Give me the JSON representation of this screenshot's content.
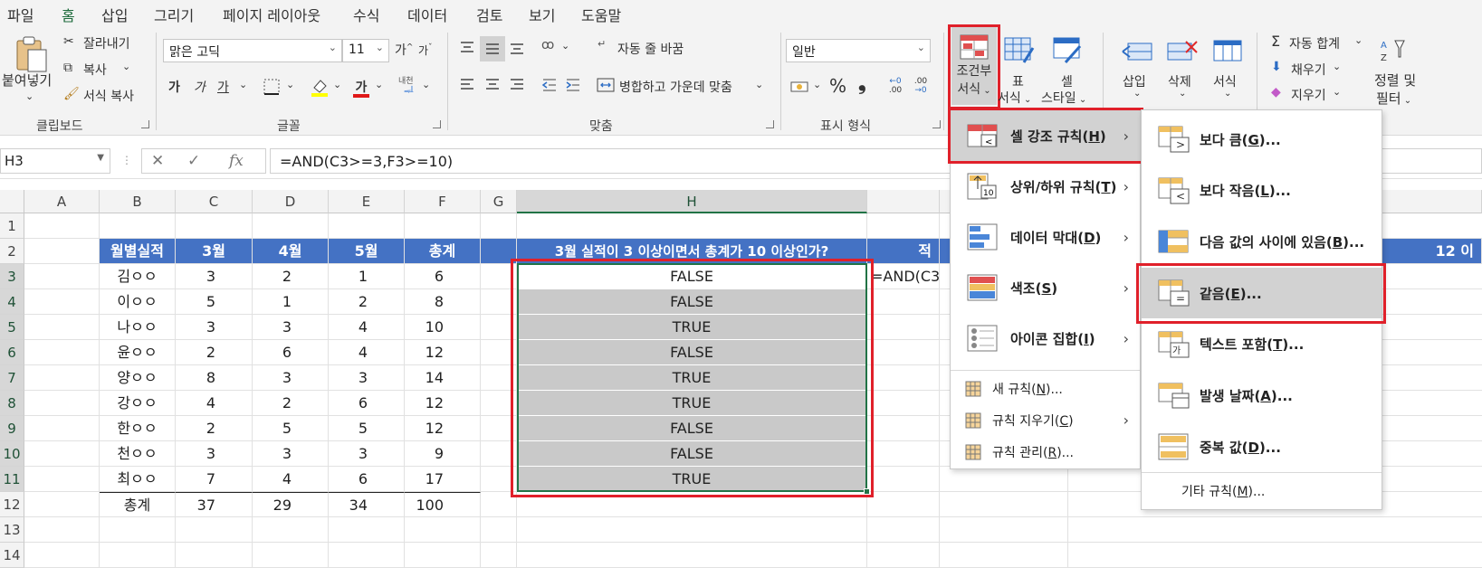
{
  "menubar": {
    "items": [
      "파일",
      "홈",
      "삽입",
      "그리기",
      "페이지 레이아웃",
      "수식",
      "데이터",
      "검토",
      "보기",
      "도움말"
    ],
    "active": "홈"
  },
  "ribbon": {
    "clipboard": {
      "paste": "붙여넣기",
      "cut": "잘라내기",
      "copy": "복사",
      "format_painter": "서식 복사",
      "label": "클립보드"
    },
    "font": {
      "font_name": "맑은 고딕",
      "font_size": "11",
      "grow": "가",
      "shrink": "가",
      "bold": "가",
      "italic": "가",
      "underline": "가",
      "font_color_glyph": "가",
      "phonetic": "내천",
      "label": "글꼴"
    },
    "alignment": {
      "wrap_text": "자동 줄 바꿈",
      "merge_center": "병합하고 가운데 맞춤",
      "label": "맞춤"
    },
    "number": {
      "format": "일반",
      "percent": "%",
      "comma": "❟",
      "inc_decimal": ".00",
      "dec_decimal": ".00",
      "label": "표시 형식"
    },
    "styles": {
      "conditional_line1": "조건부",
      "conditional_line2": "서식",
      "table_line1": "표",
      "table_line2": "서식",
      "cell_line1": "셀",
      "cell_line2": "스타일"
    },
    "cells": {
      "insert": "삽입",
      "delete": "삭제",
      "format": "서식"
    },
    "editing": {
      "autosum": "자동 합계",
      "fill": "채우기",
      "clear": "지우기",
      "sort_line1": "정렬 및",
      "sort_line2": "필터"
    }
  },
  "formula_bar": {
    "name_box": "H3",
    "fx": "fx",
    "formula": "=AND(C3>=3,F3>=10)"
  },
  "sheet": {
    "columns": [
      "A",
      "B",
      "C",
      "D",
      "E",
      "F",
      "G",
      "H"
    ],
    "rows": [
      "1",
      "2",
      "3",
      "4",
      "5",
      "6",
      "7",
      "8",
      "9",
      "10",
      "11",
      "12",
      "13",
      "14"
    ],
    "table_headers": [
      "월별실적",
      "3월",
      "4월",
      "5월",
      "총계"
    ],
    "table_rows": [
      [
        "김ㅇㅇ",
        "3",
        "2",
        "1",
        "6"
      ],
      [
        "이ㅇㅇ",
        "5",
        "1",
        "2",
        "8"
      ],
      [
        "나ㅇㅇ",
        "3",
        "3",
        "4",
        "10"
      ],
      [
        "윤ㅇㅇ",
        "2",
        "6",
        "4",
        "12"
      ],
      [
        "양ㅇㅇ",
        "8",
        "3",
        "3",
        "14"
      ],
      [
        "강ㅇㅇ",
        "4",
        "2",
        "6",
        "12"
      ],
      [
        "한ㅇㅇ",
        "2",
        "5",
        "5",
        "12"
      ],
      [
        "천ㅇㅇ",
        "3",
        "3",
        "3",
        "9"
      ],
      [
        "최ㅇㅇ",
        "7",
        "4",
        "6",
        "17"
      ]
    ],
    "total_row": [
      "총계",
      "37",
      "29",
      "34",
      "100"
    ],
    "h_header": "3월 실적이 3 이상이면서 총계가 10 이상인가?",
    "h_values": [
      "FALSE",
      "FALSE",
      "TRUE",
      "FALSE",
      "TRUE",
      "TRUE",
      "FALSE",
      "FALSE",
      "TRUE"
    ],
    "i_header_partial": "적",
    "i3_partial": "=AND(C3>",
    "right_partial": "12 이"
  },
  "cf_menu": {
    "items": [
      {
        "label": "셀 강조 규칙",
        "key": "H"
      },
      {
        "label": "상위/하위 규칙",
        "key": "T"
      },
      {
        "label": "데이터 막대",
        "key": "D"
      },
      {
        "label": "색조",
        "key": "S"
      },
      {
        "label": "아이콘 집합",
        "key": "I"
      }
    ],
    "small_items": [
      {
        "label": "새 규칙",
        "key": "N",
        "suffix": "..."
      },
      {
        "label": "규칙 지우기",
        "key": "C",
        "suffix": ""
      },
      {
        "label": "규칙 관리",
        "key": "R",
        "suffix": "..."
      }
    ]
  },
  "sub_menu": {
    "items": [
      {
        "label": "보다 큼",
        "key": "G"
      },
      {
        "label": "보다 작음",
        "key": "L"
      },
      {
        "label": "다음 값의 사이에 있음",
        "key": "B"
      },
      {
        "label": "같음",
        "key": "E"
      },
      {
        "label": "텍스트 포함",
        "key": "T"
      },
      {
        "label": "발생 날짜",
        "key": "A"
      },
      {
        "label": "중복 값",
        "key": "D"
      }
    ],
    "more": {
      "label": "기타 규칙",
      "key": "M"
    }
  },
  "colors": {
    "accent_green": "#217346",
    "header_blue": "#4472c4",
    "highlight_red": "#e0202a",
    "selection_gray": "#c9c9c9"
  }
}
